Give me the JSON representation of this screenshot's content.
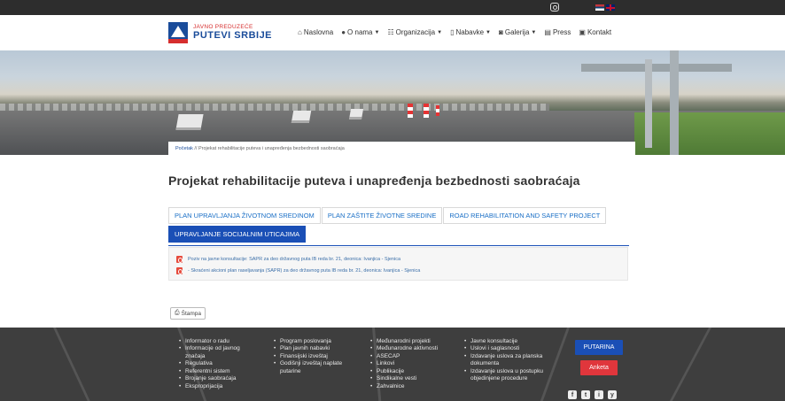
{
  "header": {
    "logo": {
      "small": "JAVNO PREDUZEĆE",
      "big": "PUTEVI SRBIJE"
    },
    "nav": [
      {
        "icon": "home-icon",
        "label": "Naslovna",
        "has_caret": false
      },
      {
        "icon": "users-icon",
        "label": "O nama",
        "has_caret": true
      },
      {
        "icon": "sitemap-icon",
        "label": "Organizacija",
        "has_caret": true
      },
      {
        "icon": "document-icon",
        "label": "Nabavke",
        "has_caret": true
      },
      {
        "icon": "camera-icon",
        "label": "Galerija",
        "has_caret": true
      },
      {
        "icon": "newspaper-icon",
        "label": "Press",
        "has_caret": false
      },
      {
        "icon": "contact-card-icon",
        "label": "Kontakt",
        "has_caret": false
      }
    ]
  },
  "breadcrumb": {
    "home": "Početak",
    "separator": "//",
    "current": "Projekat rehabilitacije puteva i unapređenja bezbednosti saobraćaja"
  },
  "page_title": "Projekat rehabilitacije puteva i unapređenja bezbednosti saobraćaja",
  "tabs": [
    {
      "label": "PLAN UPRAVLJANJA ŽIVOTNOM SREDINOM",
      "active": false
    },
    {
      "label": "PLAN ZAŠTITE ŽIVOTNE SREDINE",
      "active": false
    },
    {
      "label": "ROAD REHABILITATION AND SAFETY PROJECT",
      "active": false
    },
    {
      "label": "UPRAVLJANJE SOCIJALNIM UTICAJIMA",
      "active": true
    }
  ],
  "documents": [
    "Poziv na javne konsultacije: SAPR za deo državnog puta IB reda br. 21, deonica: Ivanjica - Sjenica",
    "- Skraćeni akcioni plan raseljavanja (SAPR) za deo državnog puta IB reda br. 21, deonica: Ivanjica - Sjenica"
  ],
  "print_label": "Štampa",
  "footer": {
    "col1": [
      "Informator o radu",
      "Informacije od javnog značaja",
      "Regulativa",
      "Referentni sistem",
      "Brojanje saobraćaja",
      "Eksproprijacija"
    ],
    "col2": [
      "Program poslovanja",
      "Plan javnih nabavki",
      "Finansijski izveštaj",
      "Godišnji izveštaj naplate putarine"
    ],
    "col3": [
      "Međunarodni projekti",
      "Međunarodne aktivnosti",
      "ASECAP",
      "Linkovi",
      "Publikacije",
      "Sindikalne vesti",
      "Zahvalnice"
    ],
    "col4": [
      "Javne konsultacije",
      "Uslovi i saglasnosti",
      "Izdavanje uslova za planska dokumenta",
      "Izdavanje uslova u postupku objedinjene procedure"
    ],
    "btn_putarina": "PUTARINA",
    "btn_anketa": "Anketa",
    "social": [
      "f",
      "t",
      "i",
      "y"
    ]
  },
  "colors": {
    "brand_blue": "#1a4fb6",
    "brand_red": "#e0363c",
    "footer_bg": "#3e3e3e"
  }
}
